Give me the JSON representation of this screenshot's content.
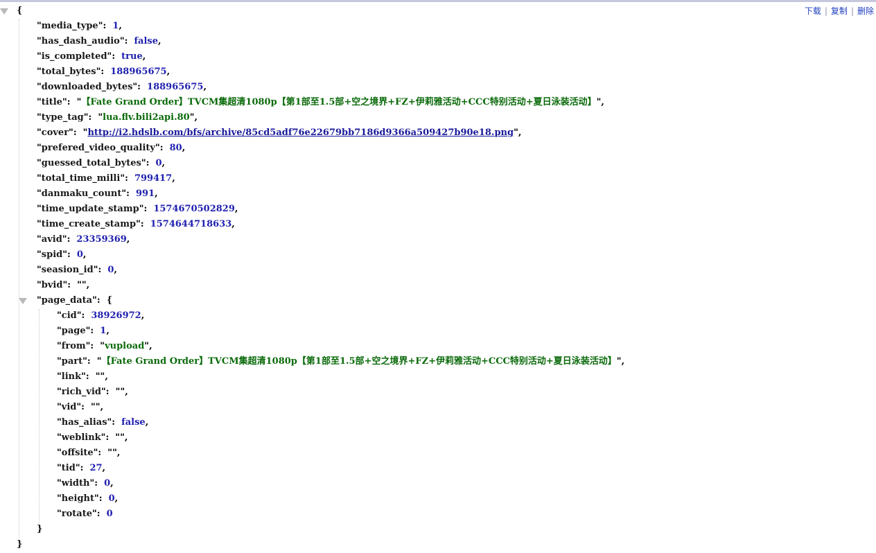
{
  "toolbar": {
    "download": "下载",
    "copy": "复制",
    "delete": "删除"
  },
  "json": {
    "open_brace": "{",
    "close_brace": "}",
    "fields": [
      {
        "key": "media_type",
        "value": "1",
        "type": "number"
      },
      {
        "key": "has_dash_audio",
        "value": "false",
        "type": "bool"
      },
      {
        "key": "is_completed",
        "value": "true",
        "type": "bool"
      },
      {
        "key": "total_bytes",
        "value": "188965675",
        "type": "number"
      },
      {
        "key": "downloaded_bytes",
        "value": "188965675",
        "type": "number"
      },
      {
        "key": "title",
        "value": "【Fate Grand Order】TVCM集超清1080p【第1部至1.5部+空之境界+FZ+伊莉雅活动+CCC特别活动+夏日泳装活动】",
        "type": "string"
      },
      {
        "key": "type_tag",
        "value": "lua.flv.bili2api.80",
        "type": "string"
      },
      {
        "key": "cover",
        "value": "http://i2.hdslb.com/bfs/archive/85cd5adf76e22679bb7186d9366a509427b90e18.png",
        "type": "url"
      },
      {
        "key": "prefered_video_quality",
        "value": "80",
        "type": "number"
      },
      {
        "key": "guessed_total_bytes",
        "value": "0",
        "type": "number"
      },
      {
        "key": "total_time_milli",
        "value": "799417",
        "type": "number"
      },
      {
        "key": "danmaku_count",
        "value": "991",
        "type": "number"
      },
      {
        "key": "time_update_stamp",
        "value": "1574670502829",
        "type": "number"
      },
      {
        "key": "time_create_stamp",
        "value": "1574644718633",
        "type": "number"
      },
      {
        "key": "avid",
        "value": "23359369",
        "type": "number"
      },
      {
        "key": "spid",
        "value": "0",
        "type": "number"
      },
      {
        "key": "seasion_id",
        "value": "0",
        "type": "number"
      },
      {
        "key": "bvid",
        "value": "",
        "type": "string"
      }
    ],
    "page_data": {
      "key": "page_data",
      "open_brace": "{",
      "close_brace": "}",
      "fields": [
        {
          "key": "cid",
          "value": "38926972",
          "type": "number"
        },
        {
          "key": "page",
          "value": "1",
          "type": "number"
        },
        {
          "key": "from",
          "value": "vupload",
          "type": "string"
        },
        {
          "key": "part",
          "value": "【Fate Grand Order】TVCM集超清1080p【第1部至1.5部+空之境界+FZ+伊莉雅活动+CCC特别活动+夏日泳装活动】",
          "type": "string"
        },
        {
          "key": "link",
          "value": "",
          "type": "string"
        },
        {
          "key": "rich_vid",
          "value": "",
          "type": "string"
        },
        {
          "key": "vid",
          "value": "",
          "type": "string"
        },
        {
          "key": "has_alias",
          "value": "false",
          "type": "bool"
        },
        {
          "key": "weblink",
          "value": "",
          "type": "string"
        },
        {
          "key": "offsite",
          "value": "",
          "type": "string"
        },
        {
          "key": "tid",
          "value": "27",
          "type": "number"
        },
        {
          "key": "width",
          "value": "0",
          "type": "number"
        },
        {
          "key": "height",
          "value": "0",
          "type": "number"
        },
        {
          "key": "rotate",
          "value": "0",
          "type": "number"
        }
      ]
    }
  }
}
